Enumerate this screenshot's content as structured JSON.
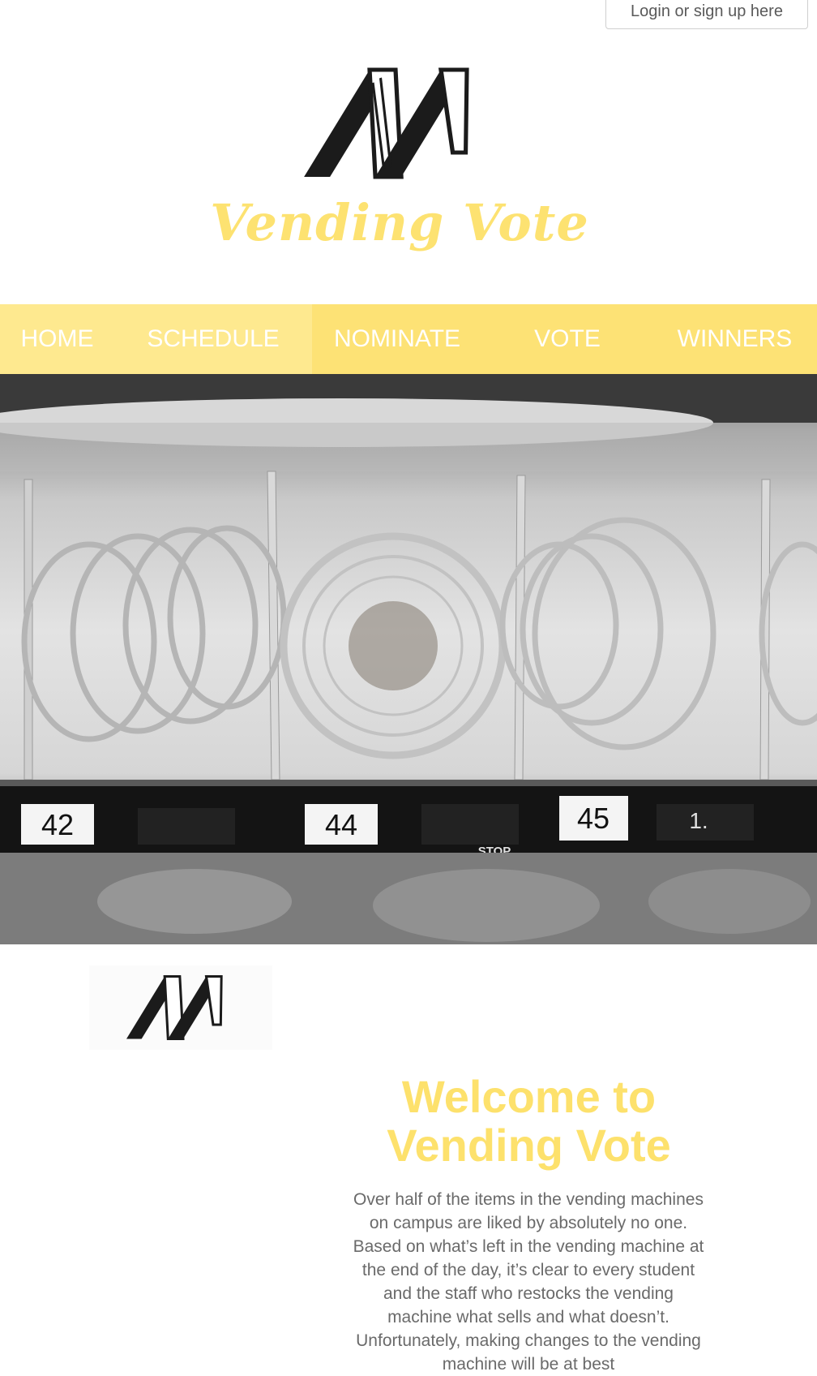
{
  "header": {
    "login_label": "Login or sign up here",
    "brand_name": "Vending Vote",
    "logo_icon": "vv-logo-icon"
  },
  "nav": {
    "items": [
      {
        "label": "HOME"
      },
      {
        "label": "SCHEDULE"
      },
      {
        "label": "NOMINATE"
      },
      {
        "label": "VOTE"
      },
      {
        "label": "WINNERS"
      }
    ]
  },
  "hero": {
    "slot_labels": [
      "42",
      "44",
      "45",
      "1."
    ],
    "stop_label": "STOP"
  },
  "main": {
    "title": "Welcome to Vending Vote",
    "intro": "Over half of the items in the vending machines on campus are liked by absolutely no one. Based on what’s left in the vending machine at the end of the day, it’s clear to every student and the staff who restocks the vending machine what sells and what doesn’t. Unfortunately, making changes to the vending machine will be at best"
  },
  "colors": {
    "accent_yellow": "#fde275",
    "nav_active": "#fee98f",
    "text_gray": "#6a6a6a"
  }
}
